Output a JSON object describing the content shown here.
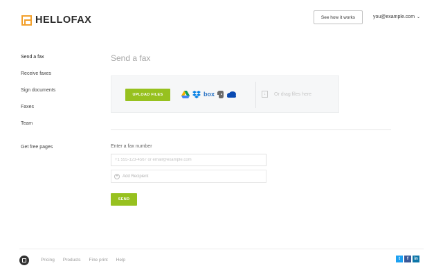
{
  "header": {
    "logo_text": "HELLOFAX",
    "how_it_works": "See how it works",
    "user_email": "you@example.com",
    "user_chevron": "⌄"
  },
  "sidebar": {
    "items": [
      {
        "label": "Send a fax",
        "active": true
      },
      {
        "label": "Receive faxes"
      },
      {
        "label": "Sign documents"
      },
      {
        "label": "Faxes"
      },
      {
        "label": "Team"
      }
    ],
    "extra": "Get free pages"
  },
  "main": {
    "title": "Send a fax",
    "upload": {
      "button_label": "UPLOAD FILES",
      "services": [
        "google-drive-icon",
        "dropbox-icon",
        "box-icon",
        "evernote-icon",
        "onedrive-icon"
      ],
      "box_label": "box",
      "drag_text": "Or drag files here",
      "drag_icon": "↓"
    },
    "fax_number": {
      "label": "Enter a fax number",
      "placeholder": "+1 555-123-4567 or email@example.com",
      "value": ""
    },
    "add_recipient": "Add Recipient",
    "add_recipient_icon": "+",
    "send_label": "SEND"
  },
  "footer": {
    "links": [
      "Pricing",
      "Products",
      "Fine print",
      "Help"
    ],
    "social": [
      {
        "name": "twitter-icon",
        "glyph": "t",
        "color": "#1da1f2"
      },
      {
        "name": "facebook-icon",
        "glyph": "f",
        "color": "#3b5998"
      },
      {
        "name": "linkedin-icon",
        "glyph": "in",
        "color": "#0e76a8"
      }
    ]
  },
  "colors": {
    "accent_green": "#97c11f",
    "logo_orange": "#f2a02c"
  }
}
